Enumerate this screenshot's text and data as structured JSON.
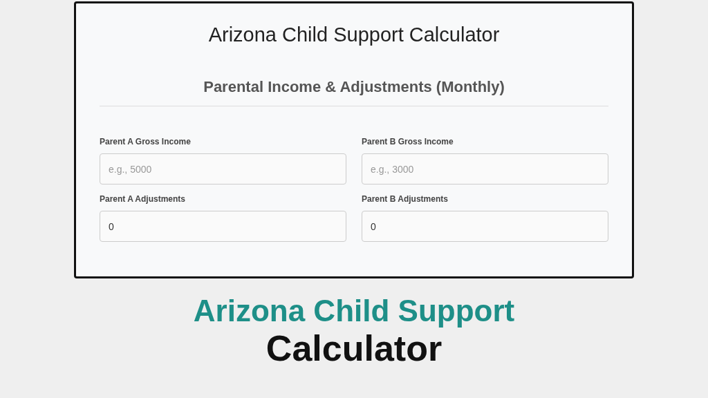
{
  "card": {
    "title": "Arizona Child Support Calculator",
    "section_title": "Parental Income & Adjustments (Monthly)",
    "fields": [
      {
        "label": "Parent A Gross Income",
        "placeholder": "e.g., 5000"
      },
      {
        "label": "Parent B Gross Income",
        "placeholder": "e.g., 3000"
      },
      {
        "label": "Parent A Adjustments",
        "value": "0"
      },
      {
        "label": "Parent B Adjustments",
        "value": "0"
      }
    ]
  },
  "banner": {
    "line_1": "Arizona Child Support",
    "line_2": "Calculator"
  }
}
